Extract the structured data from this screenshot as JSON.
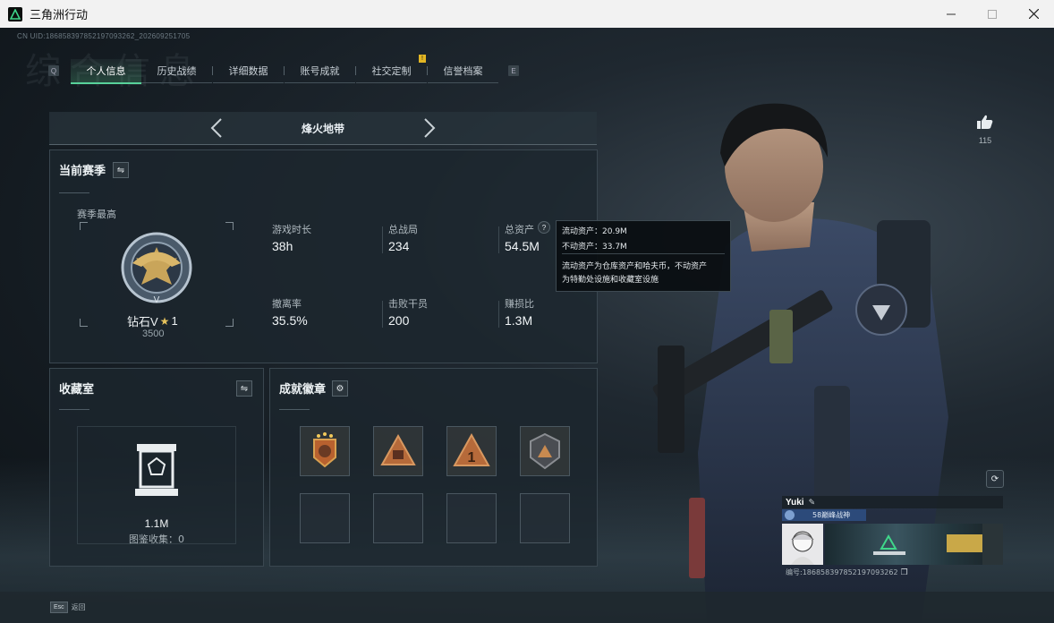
{
  "window": {
    "title": "三角洲行动"
  },
  "header": {
    "uid": "CN UID:18685839785219709326​2_2026092517​05",
    "bg_text": "综合信息"
  },
  "tabs": [
    {
      "label": "个人信息",
      "active": true
    },
    {
      "label": "历史战绩"
    },
    {
      "label": "详细数据"
    },
    {
      "label": "账号成就"
    },
    {
      "label": "社交定制",
      "badge": "!"
    },
    {
      "label": "信誉档案"
    }
  ],
  "tab_keys": {
    "left": "Q",
    "right": "E"
  },
  "mode": {
    "title": "烽火地带"
  },
  "season": {
    "title": "当前赛季",
    "highest_label": "赛季最高",
    "rank_name": "钻石V",
    "rank_stars": "1",
    "rank_score": "3500",
    "stats": [
      {
        "label": "游戏时长",
        "value": "38h"
      },
      {
        "label": "总战局",
        "value": "234"
      },
      {
        "label": "总资产",
        "value": "54.5M"
      },
      {
        "label": "撤离率",
        "value": "35.5%"
      },
      {
        "label": "击败干员",
        "value": "200"
      },
      {
        "label": "赚损比",
        "value": "1.3M"
      }
    ]
  },
  "tooltip": {
    "liquid": "流动资产：20.9M",
    "fixed": "不动资产：33.7M",
    "desc1": "流动资产为仓库资产和哈夫币，不动资产",
    "desc2": "为特勤处设施和收藏室设施"
  },
  "collection": {
    "title": "收藏室",
    "value": "1.1M",
    "label": "图鉴收集：0"
  },
  "badges": {
    "title": "成就徽章"
  },
  "likes": {
    "count": "115"
  },
  "player": {
    "name": "Yuki",
    "title": "58巅峰战神",
    "id_text": "编号:18685839785219709326​2"
  },
  "footer": {
    "esc_key": "Esc",
    "back_label": "返回"
  },
  "colors": {
    "accent": "#58d19a",
    "badge_gold": "#e3b623"
  },
  "icons": [
    "thumbs-up-icon",
    "swap-icon",
    "gear-icon",
    "question-icon",
    "refresh-icon",
    "edit-icon",
    "copy-icon"
  ]
}
